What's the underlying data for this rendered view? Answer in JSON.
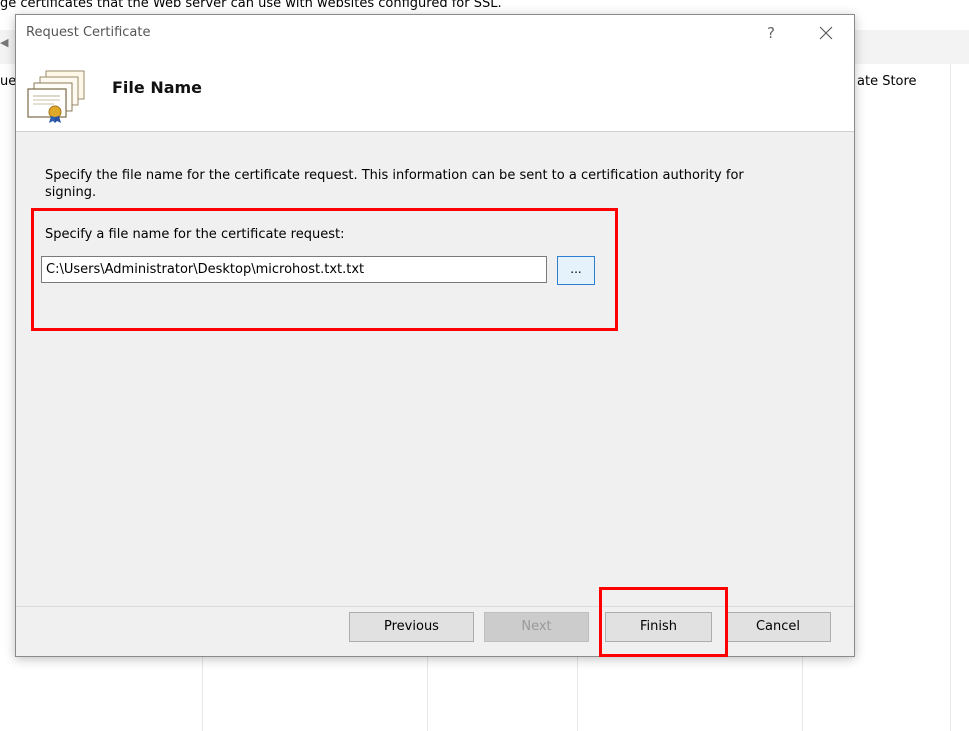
{
  "background_window": {
    "description": "ge certificates that the Web server can use with websites configured for SSL.",
    "column_left_fragment": "ue",
    "column_right_fragment": "ate Store"
  },
  "dialog": {
    "title": "Request Certificate",
    "help_glyph": "?",
    "close_glyph": "×",
    "page_title": "File Name",
    "instructions": "Specify the file name for the certificate request. This information can be sent to a certification authority for signing.",
    "field_label": "Specify a file name for the certificate request:",
    "file_path_value": "C:\\Users\\Administrator\\Desktop\\microhost.txt.txt",
    "browse_label": "...",
    "buttons": {
      "previous": "Previous",
      "next": "Next",
      "finish": "Finish",
      "cancel": "Cancel"
    }
  },
  "icons": {
    "header": "certificate-stack-icon",
    "help": "help-icon",
    "close": "close-icon"
  },
  "colors": {
    "annotation": "#ff0000",
    "dialog_bg": "#f0f0f0",
    "browse_border": "#2f7fd0"
  }
}
